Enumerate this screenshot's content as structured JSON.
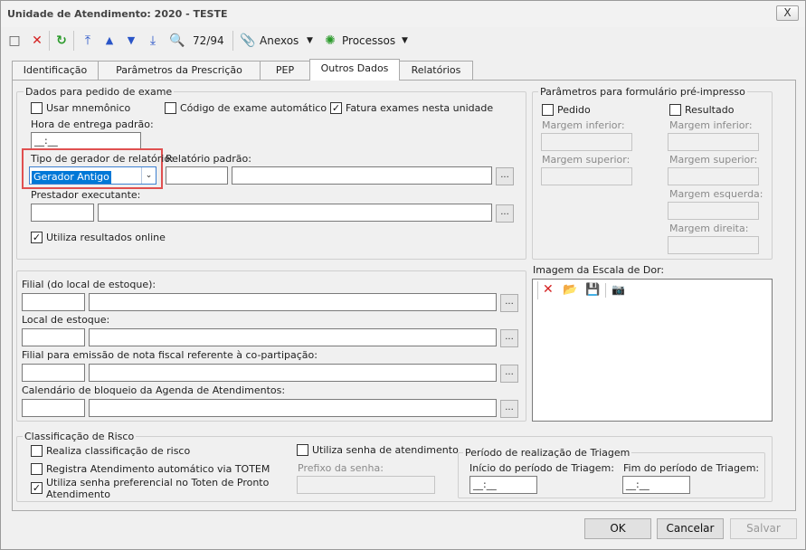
{
  "window": {
    "title": "Unidade de Atendimento: 2020 - TESTE",
    "close_label": "X"
  },
  "toolbar": {
    "record_counter": "72/94",
    "attachments_label": "Anexos",
    "processes_label": "Processos"
  },
  "tabs": [
    "Identificação",
    "Parâmetros da Prescrição",
    "PEP",
    "Outros Dados",
    "Relatórios"
  ],
  "exam_group": {
    "title": "Dados para pedido de exame",
    "use_mnemonic": "Usar mnemônico",
    "auto_exam_code": "Código de exame automático",
    "bill_exams": "Fatura exames nesta unidade",
    "delivery_time_label": "Hora de entrega padrão:",
    "delivery_time_value": "__:__",
    "report_generator_label": "Tipo de gerador de relatório:",
    "report_generator_value": "Gerador Antigo",
    "default_report_label": "Relatório padrão:",
    "executor_label": "Prestador executante:",
    "online_results": "Utiliza resultados online",
    "ellipsis": "..."
  },
  "preprinted_group": {
    "title": "Parâmetros para formulário pré-impresso",
    "order_label": "Pedido",
    "result_label": "Resultado",
    "bottom_margin": "Margem inferior:",
    "top_margin": "Margem superior:",
    "left_margin": "Margem esquerda:",
    "right_margin": "Margem direita:"
  },
  "stock_group": {
    "branch_label": "Filial (do local de estoque):",
    "stock_location_label": "Local de estoque:",
    "invoice_branch_label": "Filial para emissão de nota fiscal referente à co-partipação:",
    "calendar_label": "Calendário de bloqueio da Agenda de Atendimentos:",
    "ellipsis": "..."
  },
  "pain_scale": {
    "title": "Imagem da Escala de Dor:"
  },
  "risk_group": {
    "title": "Classificação de Risco",
    "risk_classification": "Realiza classificação de risco",
    "register_totem": "Registra Atendimento automático via TOTEM",
    "preferential_line1": "Utiliza senha preferencial no Toten de Pronto",
    "preferential_line2": "Atendimento",
    "use_password": "Utiliza senha de atendimento",
    "password_prefix": "Prefixo da senha:"
  },
  "triage_group": {
    "title": "Período de realização de Triagem",
    "start_label": "Início do período de Triagem:",
    "start_value": "__:__",
    "end_label": "Fim do período de Triagem:",
    "end_value": "__:__"
  },
  "footer": {
    "ok": "OK",
    "cancel": "Cancelar",
    "save": "Salvar"
  },
  "colors": {
    "highlight_border": "#e05050",
    "selection": "#0078d7",
    "tab_active_bg": "#ffffff"
  }
}
